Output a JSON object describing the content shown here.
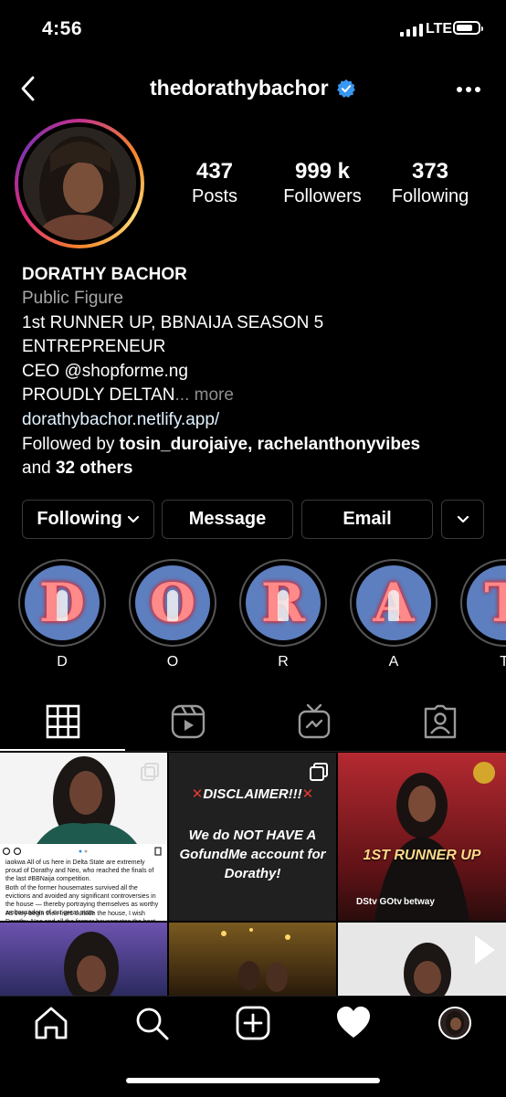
{
  "status_bar": {
    "time": "4:56",
    "network": "LTE"
  },
  "header": {
    "username": "thedorathybachor"
  },
  "stats": [
    {
      "value": "437",
      "label": "Posts"
    },
    {
      "value": "999 k",
      "label": "Followers"
    },
    {
      "value": "373",
      "label": "Following"
    }
  ],
  "bio": {
    "name": "DORATHY BACHOR",
    "category": "Public Figure",
    "line1": "1st RUNNER UP, BBNAIJA SEASON 5",
    "line2": "ENTREPRENEUR",
    "line3": "CEO @shopforme.ng",
    "line4": "PROUDLY DELTAN",
    "more": "... more",
    "link": "dorathybachor.netlify.app/",
    "followed_prefix": "Followed by ",
    "followed_names": "tosin_durojaiye, rachelanthonyvibes",
    "followed_and": "and ",
    "followed_others": "32 others"
  },
  "buttons": {
    "following": "Following",
    "message": "Message",
    "email": "Email"
  },
  "highlights": [
    {
      "letter": "D",
      "label": "D"
    },
    {
      "letter": "O",
      "label": "O"
    },
    {
      "letter": "R",
      "label": "R"
    },
    {
      "letter": "A",
      "label": "A"
    },
    {
      "letter": "T",
      "label": "T"
    }
  ],
  "posts": {
    "post1_text": "iaokwa All of us here in Delta State are extremely proud of Dorathy and Neo, who reached the finals of the last #BBNaija competition.",
    "post1_text2": "Both of the former housemates survived all the evictions and avoided any significant controversies in the house — thereby portraying themselves as worthy ambassadors of our great state.",
    "post1_text3": "As they begin their lives outside the house, I wish Dorathy, Neo and all the former housemates the best in their future endeavours. I also",
    "post2_disclaimer": "DISCLAIMER!!!",
    "post2_body": "We do NOT HAVE A GofundMe account for Dorathy!",
    "post3_banner": "1ST RUNNER UP",
    "post3_sponsor1": "DStv GOtv",
    "post3_sponsor2": "betway"
  },
  "colors": {
    "verified": "#3897f0",
    "highlight_bg": "#5d7fc0",
    "link": "#e0f1ff",
    "muted": "#a8a8a8"
  }
}
